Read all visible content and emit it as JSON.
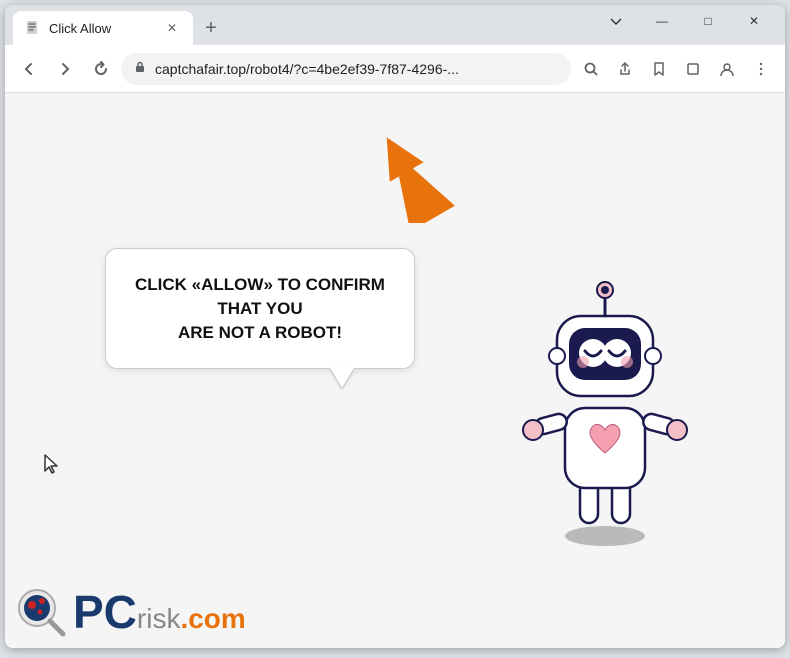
{
  "browser": {
    "tab": {
      "title": "Click Allow",
      "favicon": "⚠"
    },
    "tab_new_label": "+",
    "window_controls": {
      "minimize": "—",
      "maximize": "□",
      "close": "✕",
      "chevron": "⌄"
    },
    "toolbar": {
      "back_label": "←",
      "forward_label": "→",
      "reload_label": "✕",
      "address": "captchafair.top/robot4/?c=4be2ef39-7f87-4296-...",
      "lock_icon": "🔒",
      "search_icon": "🔍",
      "share_icon": "⎋",
      "star_icon": "☆",
      "tab_icon": "▭",
      "profile_icon": "👤",
      "menu_icon": "⋮"
    }
  },
  "content": {
    "bubble_text_line1": "CLICK «ALLOW» TO CONFIRM THAT YOU",
    "bubble_text_line2": "ARE NOT A ROBOT!",
    "arrow_color": "#E8720C"
  },
  "watermark": {
    "pc": "PC",
    "risk": "risk",
    "domain": ".com"
  }
}
